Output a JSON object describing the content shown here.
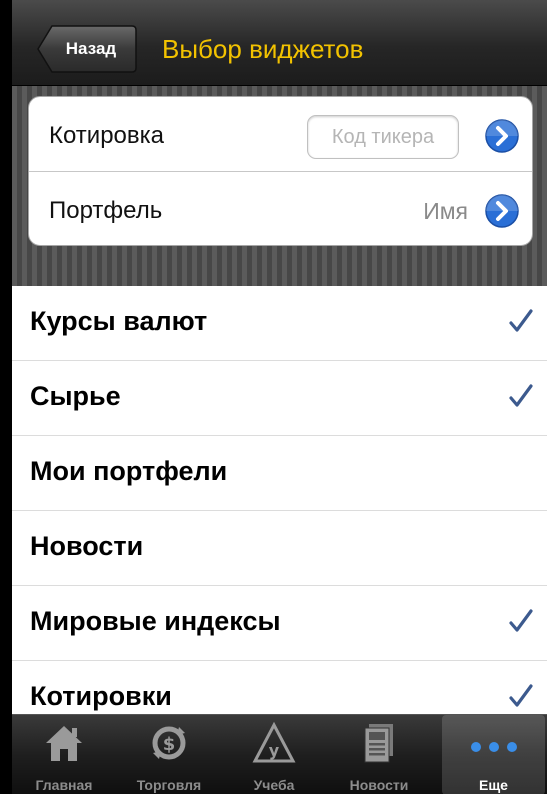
{
  "navbar": {
    "back_label": "Назад",
    "title": "Выбор виджетов"
  },
  "group": {
    "quote": {
      "label": "Котировка",
      "placeholder": "Код тикера"
    },
    "portfolio": {
      "label": "Портфель",
      "value": "Имя"
    }
  },
  "list": {
    "items": [
      {
        "label": "Курсы валют",
        "checked": true
      },
      {
        "label": "Сырье",
        "checked": true
      },
      {
        "label": "Мои портфели",
        "checked": false
      },
      {
        "label": "Новости",
        "checked": false
      },
      {
        "label": "Мировые индексы",
        "checked": true
      },
      {
        "label": "Котировки",
        "checked": true
      }
    ]
  },
  "tabs": [
    {
      "label": "Главная",
      "icon": "home-icon"
    },
    {
      "label": "Торговля",
      "icon": "trade-icon"
    },
    {
      "label": "Учеба",
      "icon": "learning-icon"
    },
    {
      "label": "Новости",
      "icon": "news-icon"
    },
    {
      "label": "Еще",
      "icon": "more-icon",
      "active": true
    }
  ],
  "colors": {
    "title": "#f2c200",
    "checkmark": "#3c5a8e",
    "disclosure": "#2a6fd6"
  }
}
